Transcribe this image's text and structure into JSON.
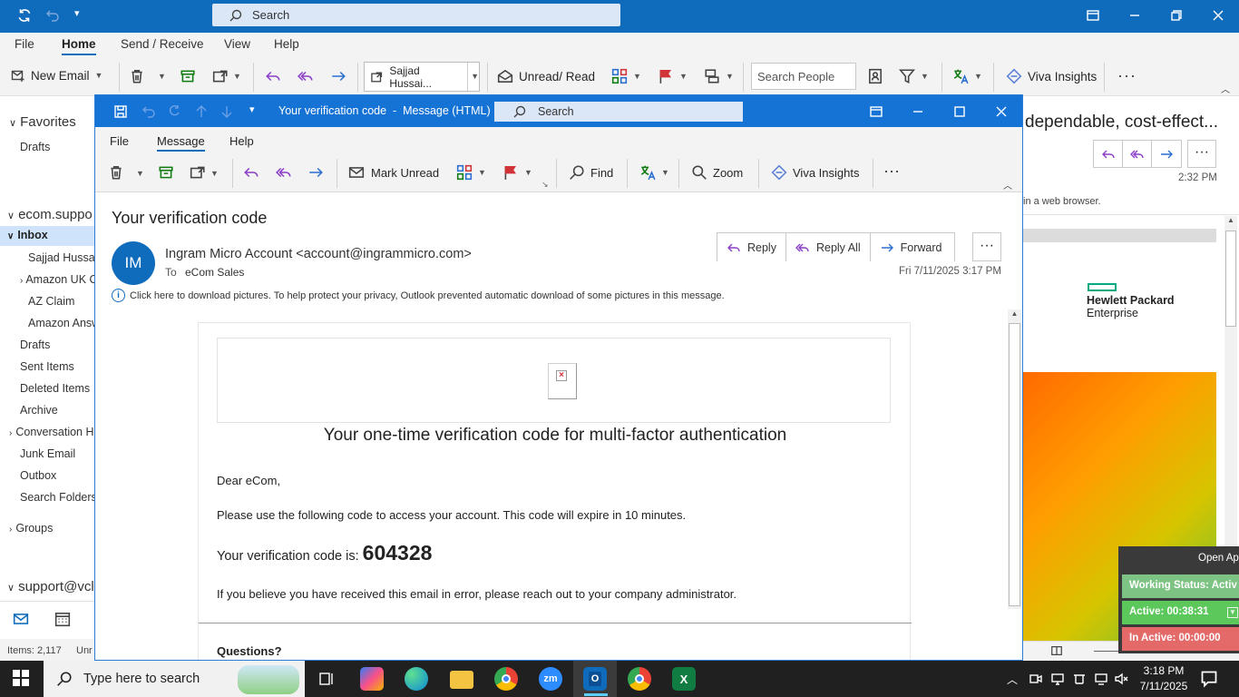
{
  "main": {
    "search_placeholder": "Search",
    "menu": [
      "File",
      "Home",
      "Send / Receive",
      "View",
      "Help"
    ],
    "ribbon": {
      "new_email": "New Email",
      "move_target": "Sajjad Hussai...",
      "unread_read": "Unread/ Read",
      "search_people": "Search People",
      "viva": "Viva Insights"
    },
    "folders": {
      "favorites": "Favorites",
      "fav_drafts": "Drafts",
      "account1": "ecom.suppo",
      "inbox": "Inbox",
      "inbox_sub": [
        "Sajjad Hussain",
        "Amazon UK O",
        "AZ Claim",
        "Amazon Answ"
      ],
      "items": [
        "Drafts",
        "Sent Items",
        "Deleted Items",
        "Archive",
        "Conversation H",
        "Junk Email",
        "Outbox",
        "Search Folders"
      ],
      "groups": "Groups",
      "account2": "support@vcl"
    },
    "status_items": "Items: 2,117",
    "status_unread": "Unr"
  },
  "message": {
    "window_title": "Your verification code  -  Message (HTML)",
    "search_placeholder": "Search",
    "menu": [
      "File",
      "Message",
      "Help"
    ],
    "ribbon": {
      "mark_unread": "Mark Unread",
      "find": "Find",
      "zoom": "Zoom",
      "viva": "Viva Insights"
    },
    "subject": "Your verification code",
    "avatar": "IM",
    "sender": "Ingram Micro Account <account@ingrammicro.com>",
    "to_label": "To",
    "to_value": "eCom Sales",
    "date": "Fri 7/11/2025 3:17 PM",
    "actions": {
      "reply": "Reply",
      "reply_all": "Reply All",
      "forward": "Forward"
    },
    "info_bar": "Click here to download pictures. To help protect your privacy, Outlook prevented automatic download of some pictures in this message.",
    "body": {
      "heading": "Your one-time verification code for multi-factor authentication",
      "greeting": "Dear eCom,",
      "line1": "Please use the following code to access your account. This code will expire in 10 minutes.",
      "code_label": "Your verification code is: ",
      "code": "604328",
      "line2": "If you believe you have received this email in error, please reach out to your company administrator.",
      "questions": "Questions?"
    }
  },
  "reading_pane": {
    "headline": "dependable, cost-effect...",
    "time": "2:32 PM",
    "browser_note": "in a web browser.",
    "hpe_line1": "Hewlett Packard",
    "hpe_line2": "Enterprise"
  },
  "status_widget": {
    "open_app": "Open Ap",
    "working_status": "Working Status: Activ",
    "active": "Active: 00:38:31",
    "inactive": "In Active: 00:00:00"
  },
  "taskbar": {
    "search_placeholder": "Type here to search",
    "zm": "zm",
    "time": "3:18 PM",
    "date": "7/11/2025"
  }
}
